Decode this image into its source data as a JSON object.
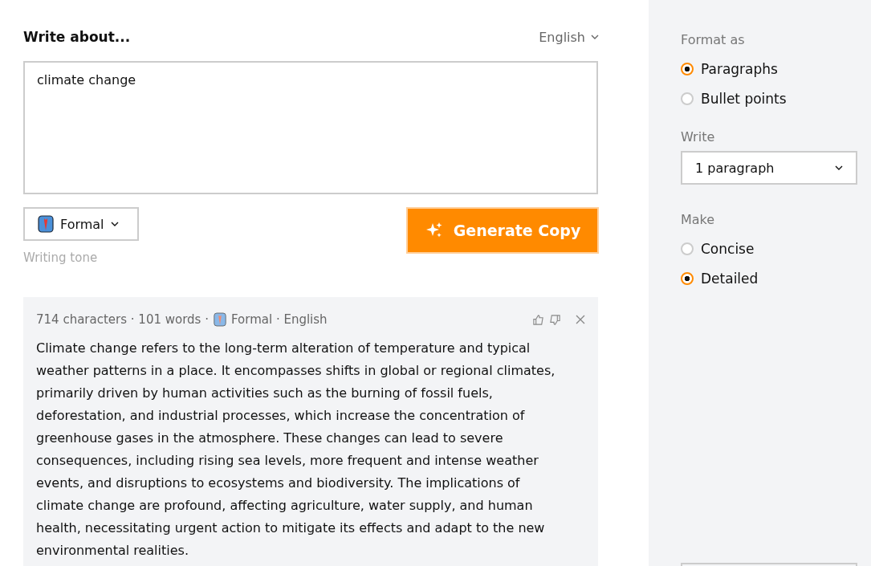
{
  "prompt": {
    "title": "Write about...",
    "language": "English",
    "value": "climate change"
  },
  "tone": {
    "label": "Formal",
    "caption": "Writing tone"
  },
  "generate_button": "Generate Copy",
  "result": {
    "meta_counts": "714 characters · 101 words ·",
    "meta_tone": "Formal · English",
    "text": "Climate change refers to the long-term alteration of temperature and typical weather patterns in a place. It encompasses shifts in global or regional climates, primarily driven by human activities such as the burning of fossil fuels, deforestation, and industrial processes, which increase the concentration of greenhouse gases in the atmosphere. These changes can lead to severe consequences, including rising sea levels, more frequent and intense weather events, and disruptions to ecosystems and biodiversity. The implications of climate change are profound, affecting agriculture, water supply, and human health, necessitating urgent action to mitigate its effects and adapt to the new environmental realities."
  },
  "sidebar": {
    "format_label": "Format as",
    "format_options": [
      {
        "label": "Paragraphs",
        "selected": true
      },
      {
        "label": "Bullet points",
        "selected": false
      }
    ],
    "write_label": "Write",
    "write_value": "1 paragraph",
    "make_label": "Make",
    "make_options": [
      {
        "label": "Concise",
        "selected": false
      },
      {
        "label": "Detailed",
        "selected": true
      }
    ]
  }
}
